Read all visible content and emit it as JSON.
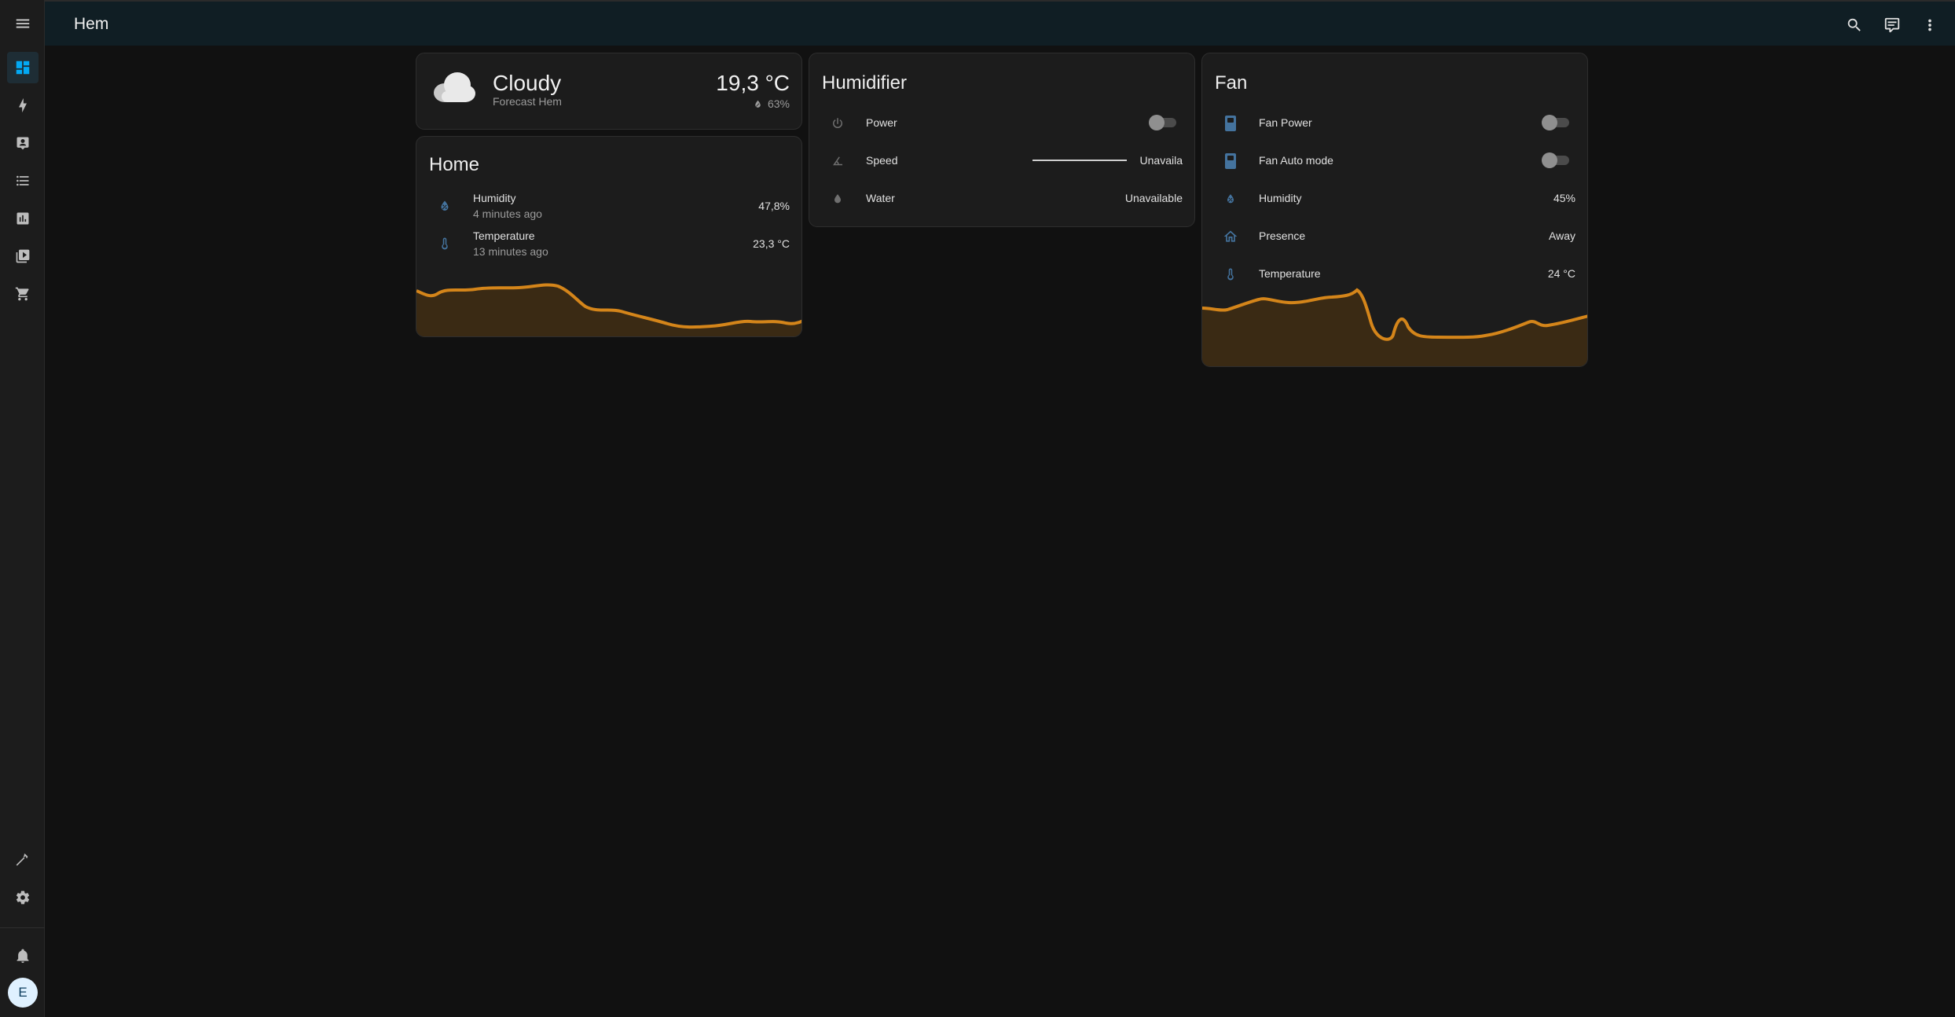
{
  "header": {
    "title": "Hem"
  },
  "weather": {
    "condition": "Cloudy",
    "forecast_label": "Forecast Hem",
    "temperature": "19,3 °C",
    "humidity": "63%"
  },
  "home": {
    "title": "Home",
    "rows": [
      {
        "label": "Humidity",
        "sub": "4 minutes ago",
        "value": "47,8%"
      },
      {
        "label": "Temperature",
        "sub": "13 minutes ago",
        "value": "23,3 °C"
      }
    ]
  },
  "humidifier": {
    "title": "Humidifier",
    "rows": [
      {
        "label": "Power",
        "state": false
      },
      {
        "label": "Speed",
        "value": "Unavaila"
      },
      {
        "label": "Water",
        "value": "Unavailable"
      }
    ]
  },
  "fan": {
    "title": "Fan",
    "rows": [
      {
        "label": "Fan Power",
        "state": false
      },
      {
        "label": "Fan Auto mode",
        "state": false
      },
      {
        "label": "Humidity",
        "value": "45%"
      },
      {
        "label": "Presence",
        "value": "Away"
      },
      {
        "label": "Temperature",
        "value": "24 °C"
      }
    ]
  },
  "sidebar": {
    "avatar_initial": "E",
    "icons": [
      "dashboard-icon",
      "energy-icon",
      "map-icon",
      "logbook-icon",
      "history-icon",
      "media-icon",
      "shopping-cart-icon",
      "developer-tools-icon",
      "settings-icon",
      "notifications-icon"
    ]
  },
  "colors": {
    "accent": "#03a9f4",
    "graph_line": "#d4851a",
    "icon_blue": "#44739e"
  }
}
